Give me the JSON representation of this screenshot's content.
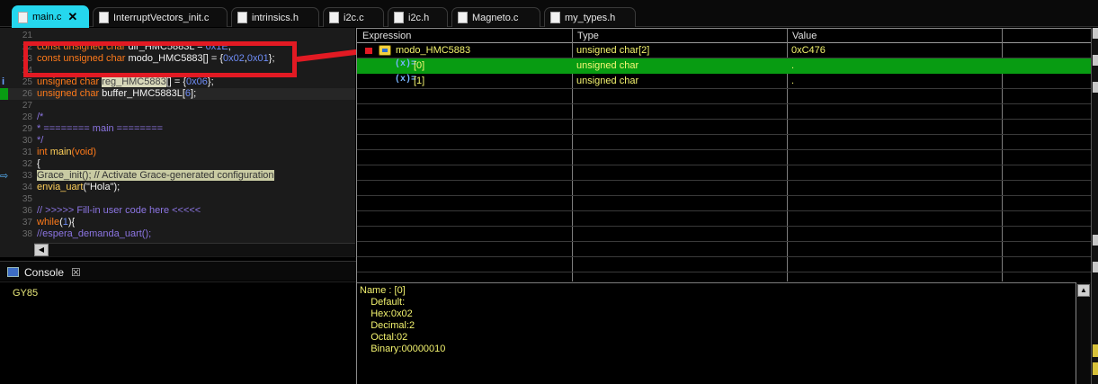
{
  "tabs": [
    {
      "label": "main.c",
      "kind": "c",
      "active": true
    },
    {
      "label": "InterruptVectors_init.c",
      "kind": "c"
    },
    {
      "label": "intrinsics.h",
      "kind": "h"
    },
    {
      "label": "i2c.c",
      "kind": "c"
    },
    {
      "label": "i2c.h",
      "kind": "h"
    },
    {
      "label": "Magneto.c",
      "kind": "c"
    },
    {
      "label": "my_types.h",
      "kind": "h"
    }
  ],
  "tab_close_glyph": "✕",
  "editor": {
    "lines": [
      {
        "n": "21",
        "segs": []
      },
      {
        "n": "22",
        "segs": [
          [
            "kw",
            "const unsigned char "
          ],
          [
            "id",
            "dir_HMC5883L = "
          ],
          [
            "num",
            "0x1E"
          ],
          [
            "id",
            ";"
          ]
        ],
        "obscured": true
      },
      {
        "n": "23",
        "segs": [
          [
            "kw",
            "const unsigned char "
          ],
          [
            "id",
            "modo_HMC5883[] =  {"
          ],
          [
            "num",
            "0x02"
          ],
          [
            "id",
            ","
          ],
          [
            "num",
            "0x01"
          ],
          [
            "id",
            "};"
          ]
        ]
      },
      {
        "n": "24",
        "segs": []
      },
      {
        "n": "25",
        "segs": [
          [
            "kw",
            "unsigned char "
          ],
          [
            "hlword",
            "reg_HMC5883"
          ],
          [
            "id",
            "[] = {"
          ],
          [
            "num",
            "0x06"
          ],
          [
            "id",
            "};"
          ]
        ],
        "marker": "info"
      },
      {
        "n": "26",
        "segs": [
          [
            "kw",
            "unsigned char "
          ],
          [
            "id",
            "buffer_HMC5883L["
          ],
          [
            "num",
            "6"
          ],
          [
            "id",
            "];"
          ]
        ],
        "marker": "bp",
        "current": true
      },
      {
        "n": "27",
        "segs": []
      },
      {
        "n": "28",
        "segs": [
          [
            "cmt",
            "/*"
          ]
        ]
      },
      {
        "n": "29",
        "segs": [
          [
            "cmt",
            " *  ======== main ========"
          ]
        ]
      },
      {
        "n": "30",
        "segs": [
          [
            "cmt",
            " */"
          ]
        ]
      },
      {
        "n": "31",
        "segs": [
          [
            "kw",
            "int "
          ],
          [
            "fn",
            "main"
          ],
          [
            "kw",
            "(void)"
          ]
        ]
      },
      {
        "n": "32",
        "segs": [
          [
            "id",
            "{"
          ]
        ]
      },
      {
        "n": "33",
        "segs": [
          [
            "hlline",
            "    Grace_init();                  // Activate Grace-generated configuration"
          ]
        ],
        "marker": "arrow"
      },
      {
        "n": "34",
        "segs": [
          [
            "fn",
            "    envia_uart"
          ],
          [
            "str",
            "(\"Hola\");"
          ]
        ]
      },
      {
        "n": "35",
        "segs": []
      },
      {
        "n": "36",
        "segs": [
          [
            "cmt",
            "    // >>>>> Fill-in user code here <<<<<"
          ]
        ]
      },
      {
        "n": "37",
        "segs": [
          [
            "kw",
            "    while"
          ],
          [
            "id",
            "("
          ],
          [
            "num",
            "1"
          ],
          [
            "id",
            "){"
          ]
        ]
      },
      {
        "n": "38",
        "segs": [
          [
            "cmt",
            "        //espera_demanda_uart();"
          ]
        ]
      }
    ]
  },
  "console": {
    "title": "Console",
    "close_glyph": "☒",
    "output": "GY85"
  },
  "expressions": {
    "headers": {
      "expression": "Expression",
      "type": "Type",
      "value": "Value"
    },
    "rows": [
      {
        "expr": "modo_HMC5883",
        "type": "unsigned char[2]",
        "value": "0xC476",
        "level": 0,
        "selected": false
      },
      {
        "expr": "[0]",
        "type": "unsigned char",
        "value": ".",
        "level": 1,
        "selected": true
      },
      {
        "expr": "[1]",
        "type": "unsigned char",
        "value": ".",
        "level": 1,
        "selected": false
      }
    ],
    "details": [
      "Name : [0]",
      "    Default:",
      "    Hex:0x02",
      "    Decimal:2",
      "    Octal:02",
      "    Binary:00000010"
    ],
    "var_icon_glyph": "(x)=",
    "scroll_up_glyph": "▲",
    "scroll_left_glyph": "◀"
  },
  "colors": {
    "active_tab": "#25d7ee",
    "selection": "#089c12",
    "annotation": "#e21a23",
    "value_text": "#f4f46e"
  }
}
